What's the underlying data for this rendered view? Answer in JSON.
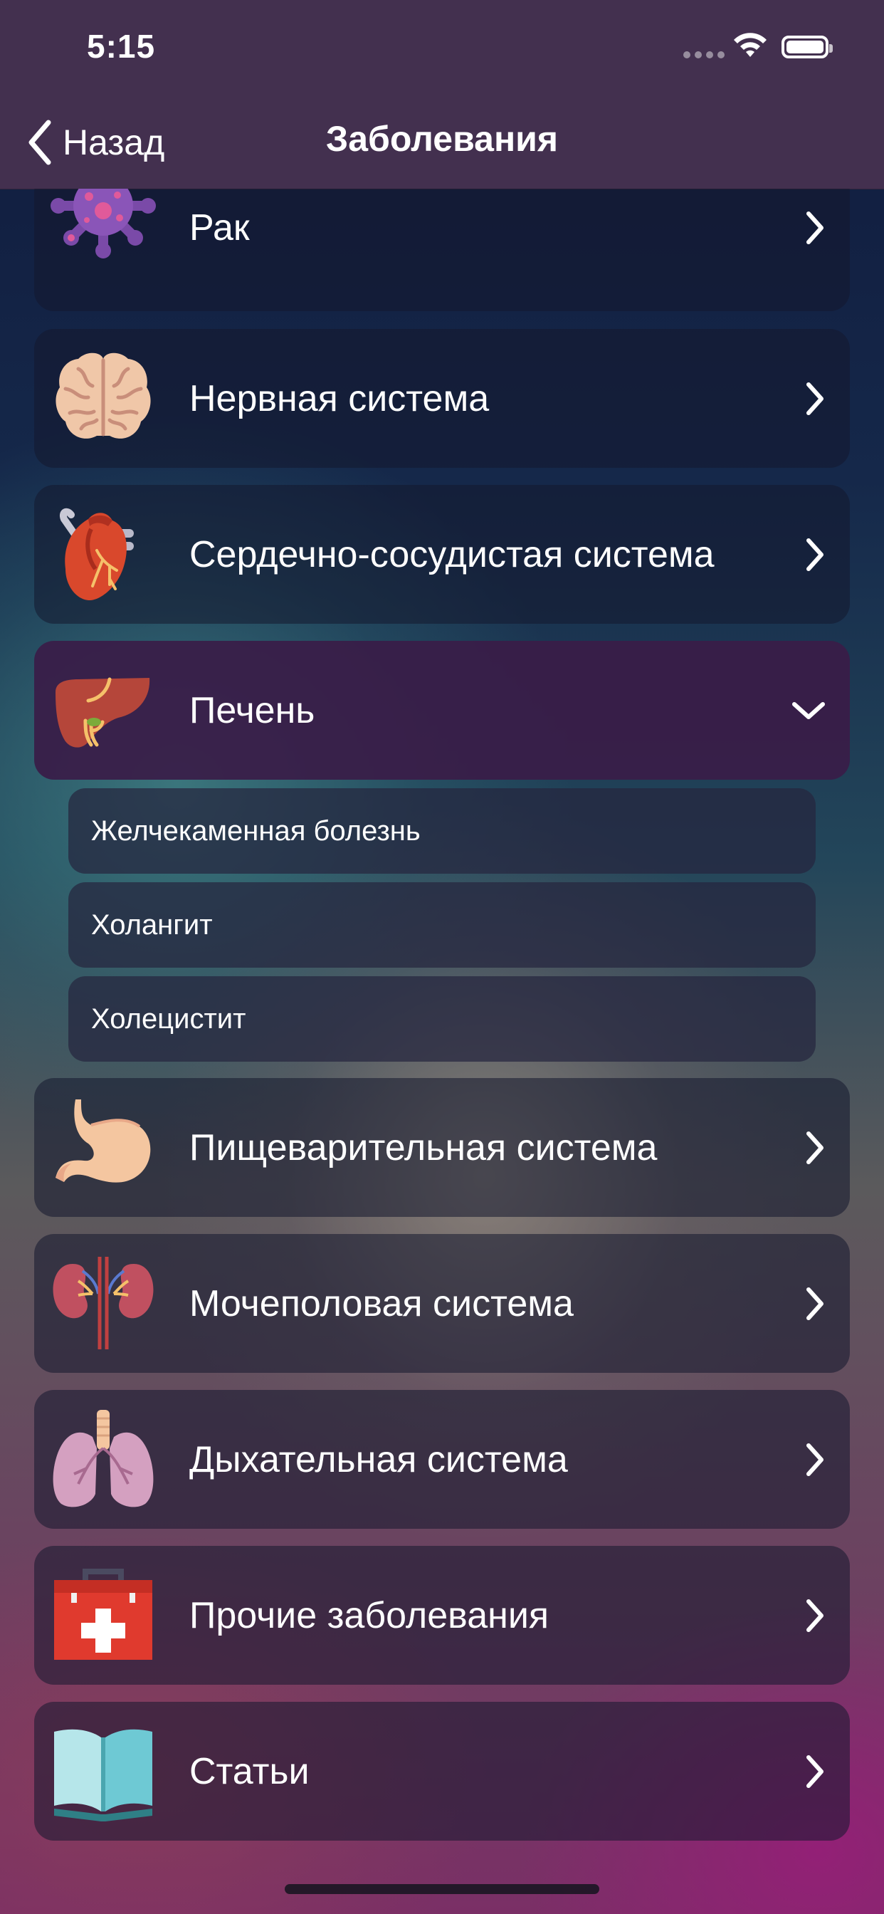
{
  "status": {
    "time": "5:15"
  },
  "nav": {
    "back_label": "Назад",
    "title": "Заболевания"
  },
  "categories": [
    {
      "label": "Рак",
      "icon": "virus-icon"
    },
    {
      "label": "Нервная система",
      "icon": "brain-icon"
    },
    {
      "label": "Сердечно-сосудистая система",
      "icon": "heart-icon"
    },
    {
      "label": "Печень",
      "icon": "liver-icon",
      "expanded": true
    },
    {
      "label": "Пищеварительная система",
      "icon": "stomach-icon"
    },
    {
      "label": "Мочеполовая система",
      "icon": "kidneys-icon"
    },
    {
      "label": "Дыхательная система",
      "icon": "lungs-icon"
    },
    {
      "label": "Прочие заболевания",
      "icon": "first-aid-kit-icon"
    },
    {
      "label": "Статьи",
      "icon": "book-icon"
    }
  ],
  "liver_items": [
    {
      "label": "Желчекаменная болезнь"
    },
    {
      "label": "Холангит"
    },
    {
      "label": "Холецистит"
    }
  ],
  "colors": {
    "header": "#43304f",
    "expanded_card": "#3a1c48"
  }
}
